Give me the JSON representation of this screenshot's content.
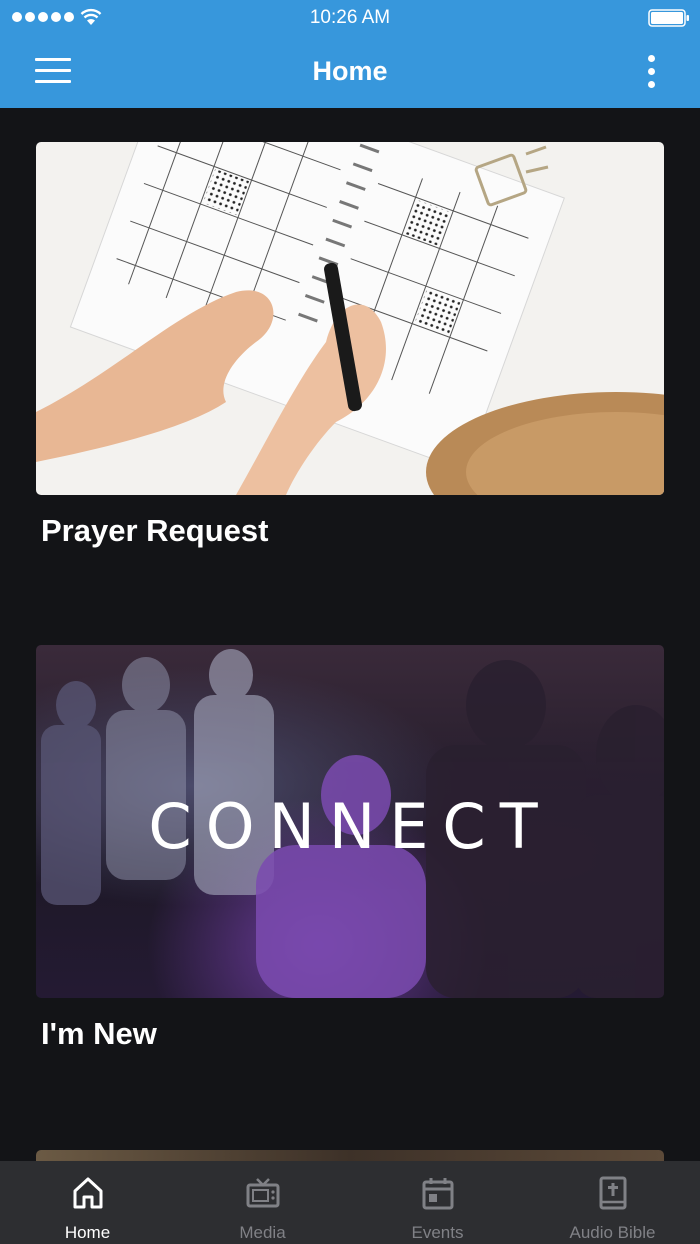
{
  "status_bar": {
    "time": "10:26 AM"
  },
  "app_bar": {
    "title": "Home"
  },
  "cards": [
    {
      "title": "Prayer Request"
    },
    {
      "title": "I'm New",
      "image_text": "CONNECT"
    }
  ],
  "tabs": [
    {
      "label": "Home",
      "icon": "home-icon",
      "active": true
    },
    {
      "label": "Media",
      "icon": "tv-icon",
      "active": false
    },
    {
      "label": "Events",
      "icon": "calendar-icon",
      "active": false
    },
    {
      "label": "Audio Bible",
      "icon": "bible-icon",
      "active": false
    }
  ],
  "colors": {
    "app_bar": "#3797dc",
    "background": "#131417",
    "tab_bar": "#2d2e31",
    "tab_active": "#ffffff",
    "tab_inactive": "#808186"
  }
}
